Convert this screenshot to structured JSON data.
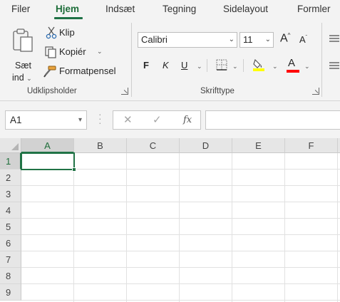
{
  "ribbon_tabs": [
    "Filer",
    "Hjem",
    "Indsæt",
    "Tegning",
    "Sidelayout",
    "Formler"
  ],
  "active_tab": "Hjem",
  "accent_color": "#217346",
  "clipboard": {
    "paste_label_line1": "Sæt",
    "paste_label_line2": "ind",
    "cut_label": "Klip",
    "copy_label": "Kopiér",
    "format_painter_label": "Formatpensel",
    "group_label": "Udklipsholder"
  },
  "font": {
    "font_name": "Calibri",
    "font_size": "11",
    "bold_label": "F",
    "italic_label": "K",
    "underline_label": "U",
    "grow_label": "A",
    "shrink_label": "A",
    "font_color_label": "A",
    "highlight_color": "#ffff00",
    "font_color": "#ff0000",
    "group_label": "Skrifttype"
  },
  "formula_bar": {
    "name_box": "A1",
    "cancel_symbol": "✕",
    "enter_symbol": "✓",
    "fx_label": "fx",
    "formula": ""
  },
  "grid": {
    "columns": [
      "A",
      "B",
      "C",
      "D",
      "E",
      "F"
    ],
    "rows": [
      "1",
      "2",
      "3",
      "4",
      "5",
      "6",
      "7",
      "8",
      "9"
    ],
    "selected_cell": "A1"
  },
  "icons": [
    "paste-icon",
    "cut-icon",
    "copy-icon",
    "format-painter-icon",
    "borders-icon",
    "highlight-icon",
    "font-color-icon",
    "align-icon"
  ]
}
